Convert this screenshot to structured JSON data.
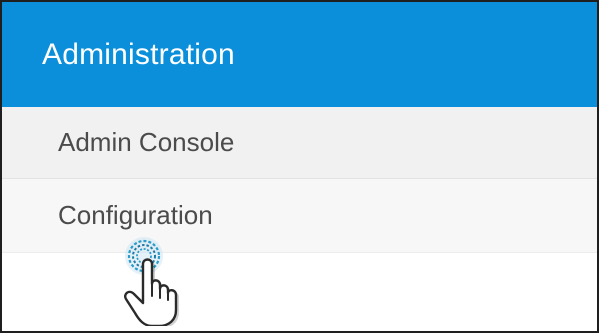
{
  "header": {
    "title": "Administration",
    "background_color": "#0b8fda"
  },
  "menu": {
    "items": [
      {
        "label": "Admin Console",
        "background_color": "#f1f1f1"
      },
      {
        "label": "Configuration",
        "background_color": "#f7f7f7"
      }
    ]
  },
  "cursor": {
    "icon": "hand-pointer-icon",
    "click_indicator": "click-ripple-icon"
  }
}
